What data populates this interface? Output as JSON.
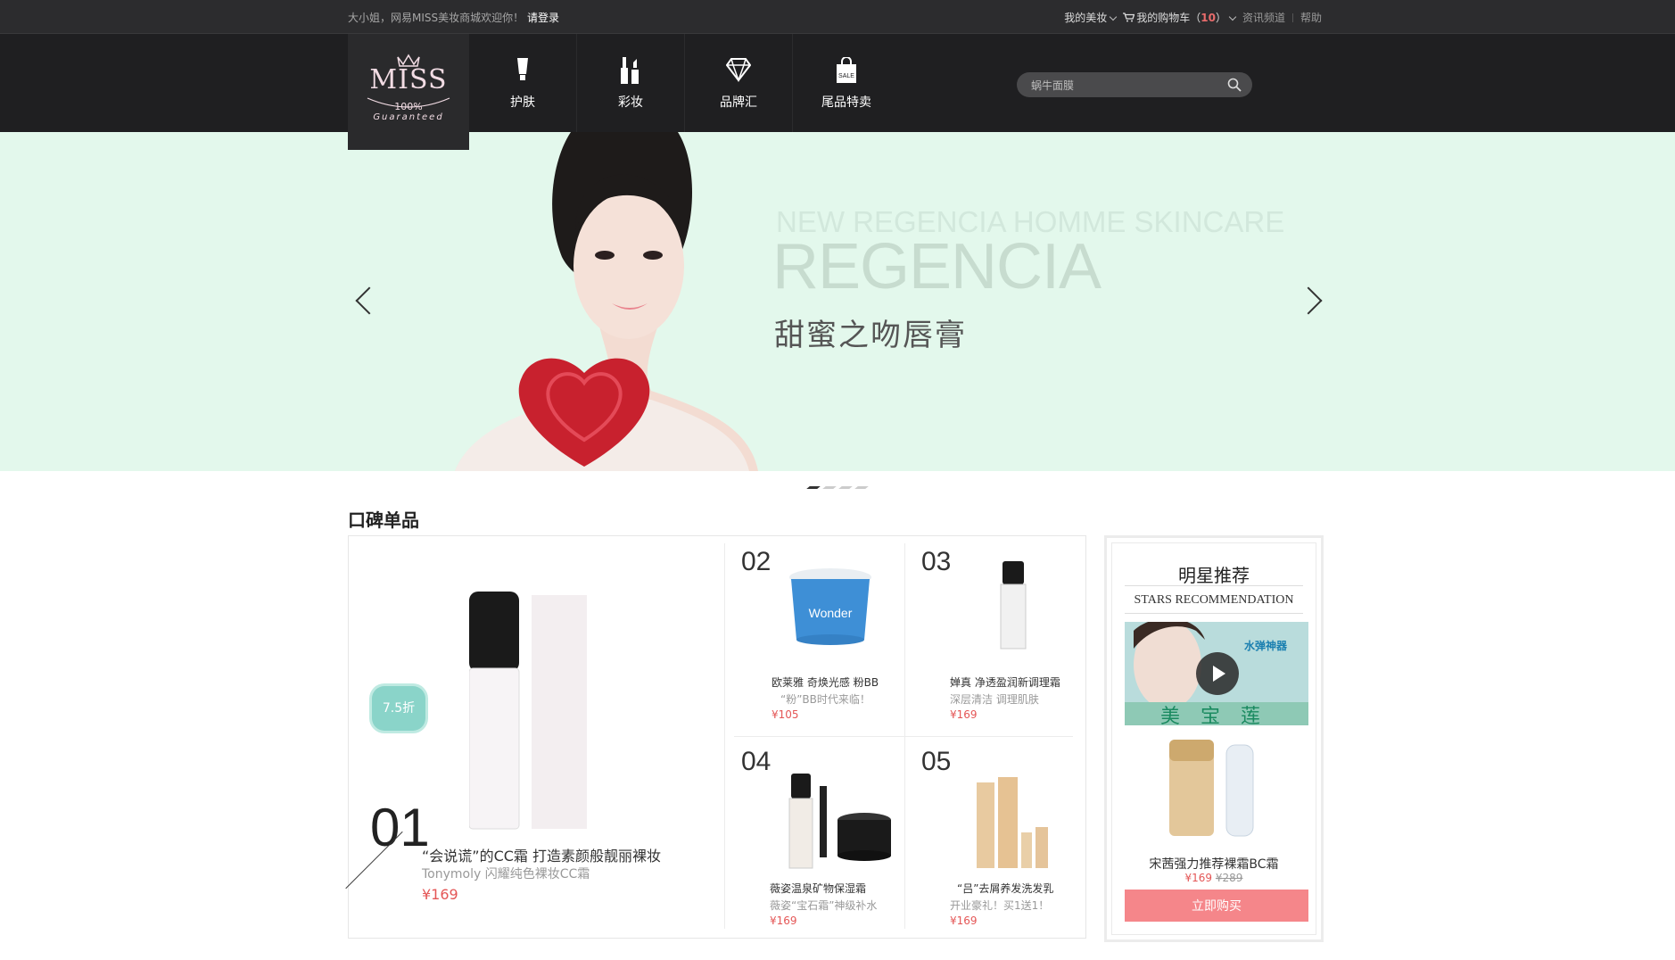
{
  "topbar": {
    "welcome": "大小姐，网易MISS美妆商城欢迎你！",
    "login": "请登录",
    "my_beauty": "我的美妆",
    "cart": "我的购物车（",
    "cart_count": "10",
    "cart_close": "）",
    "news": "资讯频道",
    "help": "帮助"
  },
  "logo": {
    "brand": "MISS",
    "percent": "100%",
    "guaranteed": "Guaranteed"
  },
  "nav": [
    {
      "label": "护肤",
      "icon": "skincare-tube-icon"
    },
    {
      "label": "彩妆",
      "icon": "makeup-lipstick-icon"
    },
    {
      "label": "品牌汇",
      "icon": "diamond-icon"
    },
    {
      "label": "尾品特卖",
      "icon": "sale-bag-icon"
    }
  ],
  "search": {
    "placeholder": "蜗牛面膜"
  },
  "banner": {
    "subtitle": "NEW REGENCIA HOMME SKINCARE",
    "title": "REGENCIA",
    "cn": "甜蜜之吻唇膏",
    "dots": 4,
    "active_dot": 0
  },
  "section": {
    "title": "口碑单品"
  },
  "products": [
    {
      "num": "01",
      "name": "“会说谎”的CC霜  打造素颜般靓丽裸妆",
      "desc": "Tonymoly  闪耀纯色裸妆CC霜",
      "price": "¥169",
      "badge": "7.5折"
    },
    {
      "num": "02",
      "name": "欧莱雅 奇焕光感 粉BB",
      "desc": "“粉”BB时代来临！",
      "price": "¥105"
    },
    {
      "num": "03",
      "name": "婵真 净透盈润新调理霜",
      "desc": "深层清洁 调理肌肤",
      "price": "¥169"
    },
    {
      "num": "04",
      "name": "薇姿温泉矿物保湿霜",
      "desc": "薇姿“宝石霜”神级补水",
      "price": "¥169"
    },
    {
      "num": "05",
      "name": "“吕”去屑养发洗发乳",
      "desc": "开业豪礼！买1送1！",
      "price": "¥169"
    }
  ],
  "stars": {
    "title": "明星推荐",
    "subtitle": "STARS RECOMMENDATION",
    "video_caption": "水弹神器",
    "video_brand": "美 宝 莲",
    "product_name": "宋茜强力推荐裸霜BC霜",
    "price": "¥169",
    "old_price": "¥289",
    "buy_label": "立即购买"
  },
  "colors": {
    "accent": "#f5868a",
    "price": "#e45656",
    "header": "#1f1f21",
    "banner_bg": "#e3f8ec"
  }
}
